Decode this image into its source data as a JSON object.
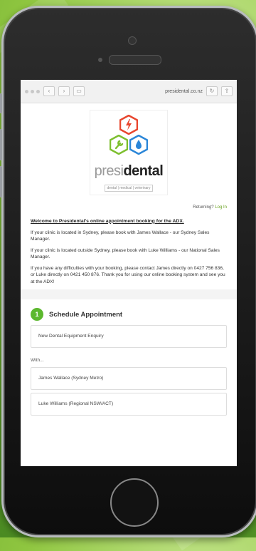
{
  "browser": {
    "url": "presidental.co.nz"
  },
  "logo": {
    "brand_light": "presi",
    "brand_bold": "dental",
    "tagline": "dental | medical | veterinary"
  },
  "page": {
    "returning_prefix": "Returning?",
    "login_link": "Log In",
    "welcome": "Welcome to Presidental's online appointment booking for the ADX.",
    "paragraphs": [
      "If your clinic is located in Sydney, please book with James Wallace - our Sydney Sales Manager.",
      "If your clinic is located outside Sydney, please book with Luke Williams - our National Sales Manager.",
      "If you have any difficulties with your booking, please contact James directly on 0427 756 836, or Luke directly on 0421 450 876. Thank you for using our online booking system and see you at the ADX!"
    ]
  },
  "schedule": {
    "step": "1",
    "title": "Schedule Appointment",
    "appointment_type": "New Dental Equipment Enquiry",
    "with_label": "With...",
    "staff": [
      "James Wallace (Sydney Metro)",
      "Luke Williams (Regional NSW/ACT)"
    ]
  },
  "colors": {
    "accent_green": "#5cb82e",
    "hex_red": "#e8462e",
    "hex_green": "#7dbf2f",
    "hex_blue": "#2a86d8"
  },
  "icons": [
    "camera-icon",
    "speaker-icon",
    "home-button-icon",
    "lightning-icon",
    "wrench-icon",
    "drop-icon"
  ]
}
